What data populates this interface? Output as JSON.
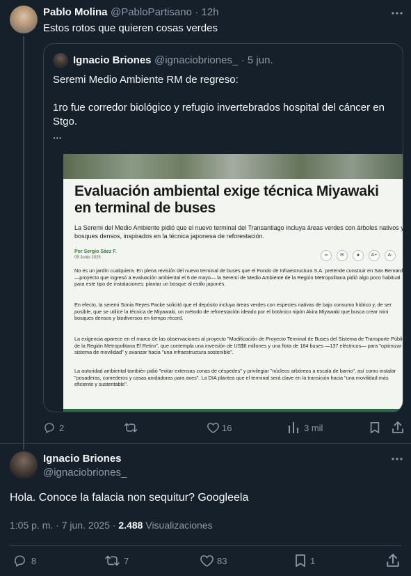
{
  "original_tweet": {
    "name": "Pablo Molina",
    "handle": "@PabloPartisano",
    "time": "· 12h",
    "text": "Estos rotos que quieren cosas verdes",
    "stats": {
      "replies": "2",
      "retweets": "",
      "likes": "16",
      "views": "3 mil"
    }
  },
  "quoted_tweet": {
    "name": "Ignacio Briones",
    "handle": "@ignaciobriones_",
    "time": "· 5 jun.",
    "line1": "Seremi Medio Ambiente RM de regreso:",
    "line2": "1ro fue corredor biológico y refugio invertebrados hospital del cáncer en",
    "line3": "Stgo.",
    "line4": "...",
    "article": {
      "title_line1": "Evaluación ambiental exige técnica Miyawaki",
      "title_line2": "en terminal de buses",
      "lead": "La Seremi del Medio Ambiente pidió que el nuevo terminal del Transantiago incluya áreas verdes con árboles nativos y bosques densos, inspirados en la técnica japonesa de reforestación.",
      "author": "Por Sergio Sáez F.",
      "date": "05 Junio 2025",
      "p1": "No es un jardín cualquiera. En plena revisión del nuevo terminal de buses que el Fondo de Infraestructura S.A. pretende construir en San Bernardo —proyecto que ingresó a evaluación ambiental el 6 de mayo— la Seremi de Medio Ambiente de la Región Metropolitana pidió algo poco habitual para este tipo de instalaciones: plantar un bosque al estilo japonés.",
      "p2": "En efecto, la seremi Sonia Reyes Packe solicitó que el depósito incluya áreas verdes con especies nativas de bajo consumo hídrico y, de ser posible, que se utilice la técnica de Miyawaki, un método de reforestación ideado por el botánico nipón Akira Miyawaki que busca crear mini bosques densos y biodiversos en tiempo récord.",
      "p3": "La exigencia aparece en el marco de las observaciones al proyecto \"Modificación de Proyecto Terminal de Buses del Sistema de Transporte Público de la Región Metropolitana El Retiro\", que contempla una inversión de US$6 millones y una flota de 184 buses —137 eléctricos— para \"optimizar el sistema de movilidad\" y avanzar hacia \"una infraestructura sostenible\".",
      "p4": "La autoridad ambiental también pidió \"evitar extensas zonas de céspedes\" y privilegiar \"núcleos arbóreos a escala de barrio\", así como instalar \"posaderas, comederos y casas anidadoras para aves\". La DIA plantea que el terminal será clave en la transición hacia \"una movilidad más eficiente y sustentable\"."
    }
  },
  "reply_tweet": {
    "name": "Ignacio Briones",
    "handle": "@ignaciobriones_",
    "text": "Hola. Conoce la falacia non sequitur? Googleela",
    "timestamp": "1:05 p. m. · 7 jun. 2025 ·",
    "views_count": "2.488",
    "views_label": "Visualizaciones",
    "stats": {
      "replies": "8",
      "retweets": "7",
      "likes": "83",
      "bookmarks": "1"
    }
  },
  "colors": {
    "background": "#15202b",
    "muted": "#8b98a5",
    "text": "#f7f9f9",
    "border": "#38444d"
  }
}
